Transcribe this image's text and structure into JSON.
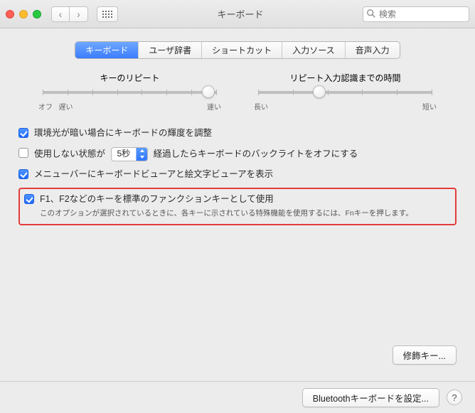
{
  "window": {
    "title": "キーボード"
  },
  "search": {
    "placeholder": "検索"
  },
  "tabs": [
    "キーボード",
    "ユーザ辞書",
    "ショートカット",
    "入力ソース",
    "音声入力"
  ],
  "sliders": {
    "repeat": {
      "label": "キーのリピート",
      "left1": "オフ",
      "left2": "遅い",
      "right": "速い",
      "thumb_pct": 95
    },
    "delay": {
      "label": "リピート入力認識までの時間",
      "left": "長い",
      "right": "短い",
      "thumb_pct": 35
    }
  },
  "checks": {
    "brightness": {
      "checked": true,
      "label": "環境光が暗い場合にキーボードの輝度を調整"
    },
    "idle": {
      "checked": false,
      "prefix": "使用しない状態が",
      "value": "5秒",
      "suffix": "経過したらキーボードのバックライトをオフにする"
    },
    "viewer": {
      "checked": true,
      "label": "メニューバーにキーボードビューアと絵文字ビューアを表示"
    },
    "fnkeys": {
      "checked": true,
      "label": "F1、F2などのキーを標準のファンクションキーとして使用",
      "sub": "このオプションが選択されているときに、各キーに示されている特殊機能を使用するには、Fnキーを押します。"
    }
  },
  "buttons": {
    "modifier": "修飾キー...",
    "bluetooth": "Bluetoothキーボードを設定..."
  }
}
